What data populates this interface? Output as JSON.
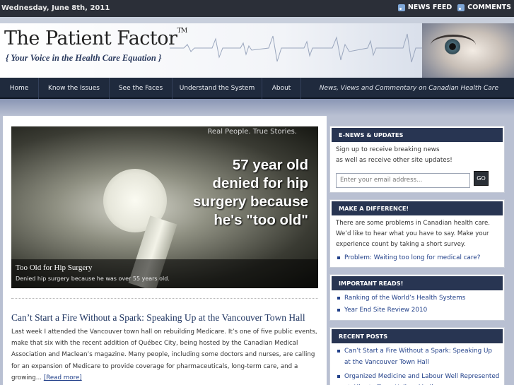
{
  "topbar": {
    "date": "Wednesday, June 8th, 2011",
    "links": [
      {
        "label": "NEWS FEED",
        "icon": "rss-icon"
      },
      {
        "label": "COMMENTS",
        "icon": "rss-icon"
      }
    ]
  },
  "header": {
    "title": "The Patient Factor",
    "trademark": "TM",
    "tagline": "{ Your Voice in the Health Care Equation }"
  },
  "nav": {
    "items": [
      "Home",
      "Know the Issues",
      "See the Faces",
      "Understand the System",
      "About"
    ],
    "tagline": "News, Views and Commentary on Canadian Health Care"
  },
  "slider": {
    "kicker": "Real People. True Stories.",
    "headline": "57 year old denied for hip surgery because he's \"too old\"",
    "caption_title": "Too Old for Hip Surgery",
    "caption_desc": "Denied hip surgery because he was over 55 years old."
  },
  "post": {
    "title": "Can’t Start a Fire Without a Spark: Speaking Up at the Vancouver Town Hall",
    "excerpt": "Last week I attended the Vancouver town hall on rebuilding Medicare. It’s one of five public events, make that six with the recent addition of Québec City, being hosted by the Canadian Medical Association and Maclean’s magazine. Many people, including some doctors and nurses, are calling for an expansion of Medicare to provide coverage for pharmaceuticals, long-term care, and a growing...",
    "more": "[Read more]"
  },
  "sidebar": {
    "enews": {
      "heading": "E-NEWS & UPDATES",
      "text1": "Sign up to receive breaking news",
      "text2": "as well as receive other site updates!",
      "placeholder": "Enter your email address...",
      "button": "GO"
    },
    "difference": {
      "heading": "MAKE A DIFFERENCE!",
      "text": "There are some problems in Canadian health care. We’d like to hear what you have to say. Make your experience count by taking a short survey.",
      "links": [
        "Problem: Waiting too long for medical care?"
      ]
    },
    "reads": {
      "heading": "IMPORTANT READS!",
      "links": [
        "Ranking of the World’s Health Systems",
        "Year End Site Review 2010"
      ]
    },
    "recent": {
      "heading": "RECENT POSTS",
      "links": [
        "Can’t Start a Fire Without a Spark: Speaking Up at the Vancouver Town Hall",
        "Organized Medicine and Labour Well Represented at Alberta Town Hall on Medicare"
      ]
    }
  }
}
